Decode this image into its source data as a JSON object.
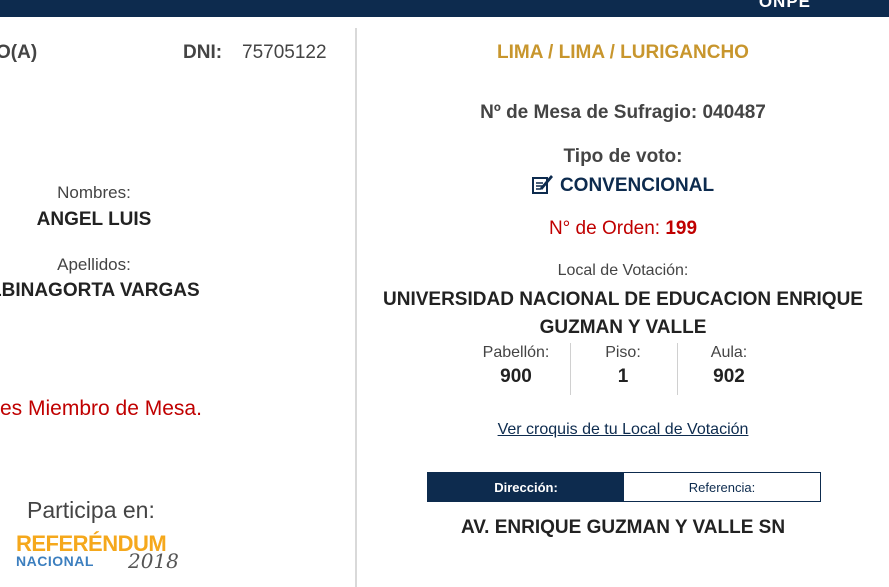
{
  "header": {
    "logo_text": "ONPE"
  },
  "voter": {
    "role_label": "O(A)",
    "dni_label": "DNI:",
    "dni_value": "75705122",
    "names_label": "Nombres:",
    "names_value": "ANGEL LUIS",
    "surnames_label": "Apellidos:",
    "surnames_value": "LBINAGORTA VARGAS",
    "mesa_member_message": "es Miembro de Mesa."
  },
  "participation": {
    "participa_label": "Participa en:",
    "logo_word": "REFERÉNDUM",
    "logo_sub": "NACIONAL",
    "logo_year": "2018"
  },
  "voting_place": {
    "location": "LIMA / LIMA / LURIGANCHO",
    "mesa_label": "Nº de Mesa de Sufragio:",
    "mesa_value": "040487",
    "tipo_label": "Tipo de voto:",
    "tipo_value": "CONVENCIONAL",
    "tipo_icon": "ballot-pen-icon",
    "orden_label": "N° de Orden:",
    "orden_value": "199",
    "local_label": "Local de Votación:",
    "local_name": "UNIVERSIDAD NACIONAL DE EDUCACION ENRIQUE GUZMAN Y VALLE",
    "pabellon_label": "Pabellón:",
    "pabellon_value": "900",
    "piso_label": "Piso:",
    "piso_value": "1",
    "aula_label": "Aula:",
    "aula_value": "902",
    "croquis_link": "Ver croquis de tu Local de Votación",
    "tabs": [
      {
        "label": "Dirección:",
        "active": true
      },
      {
        "label": "Referencia:",
        "active": false
      }
    ],
    "address": "AV. ENRIQUE GUZMAN Y VALLE SN"
  },
  "colors": {
    "navy": "#0d2b4e",
    "gold": "#c8962d",
    "red": "#c00000"
  }
}
